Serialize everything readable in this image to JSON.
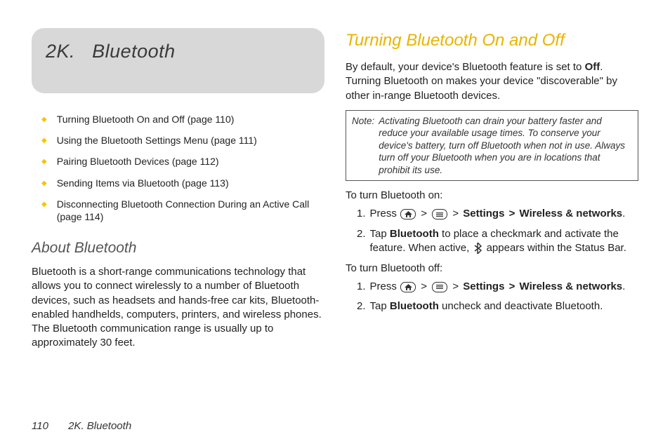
{
  "chapter": {
    "label": "2K.",
    "title": "Bluetooth"
  },
  "toc": [
    "Turning Bluetooth On and Off (page 110)",
    "Using the Bluetooth Settings Menu (page 111)",
    "Pairing Bluetooth Devices (page 112)",
    "Sending Items via Bluetooth (page 113)",
    "Disconnecting Bluetooth Connection During an Active Call (page 114)"
  ],
  "about": {
    "heading": "About Bluetooth",
    "body": "Bluetooth is a short-range communications technology that allows you to connect wirelessly to a number of Bluetooth devices, such as headsets and hands-free car kits, Bluetooth-enabled handhelds, computers, printers, and wireless phones. The Bluetooth communication range is usually up to approximately 30 feet."
  },
  "turning": {
    "heading": "Turning Bluetooth On and Off",
    "intro_pre": "By default, your device's Bluetooth feature is set to ",
    "intro_bold": "Off",
    "intro_post": ". Turning Bluetooth on makes your device \"discoverable\" by other in-range Bluetooth devices.",
    "note_label": "Note:",
    "note_body": "Activating Bluetooth can drain your battery faster and reduce your available usage times. To conserve your device's battery, turn off Bluetooth when not in use. Always turn off your Bluetooth when you are in locations that prohibit its use.",
    "on_heading": "To turn Bluetooth on:",
    "on_steps": {
      "s1_pre": "Press ",
      "s1_settings": "Settings",
      "s1_wireless": "Wireless & networks",
      "s2_pre": "Tap ",
      "s2_bold": "Bluetooth",
      "s2_mid": " to place a checkmark and activate the feature. When active, ",
      "s2_post": " appears within the Status Bar."
    },
    "off_heading": "To turn Bluetooth off:",
    "off_steps": {
      "s1_pre": "Press ",
      "s1_settings": "Settings",
      "s1_wireless": "Wireless & networks",
      "s2_pre": "Tap ",
      "s2_bold": "Bluetooth",
      "s2_post": " uncheck and deactivate Bluetooth."
    }
  },
  "footer": {
    "page_number": "110",
    "section": "2K. Bluetooth"
  },
  "glyphs": {
    "gt": ">",
    "period": "."
  }
}
